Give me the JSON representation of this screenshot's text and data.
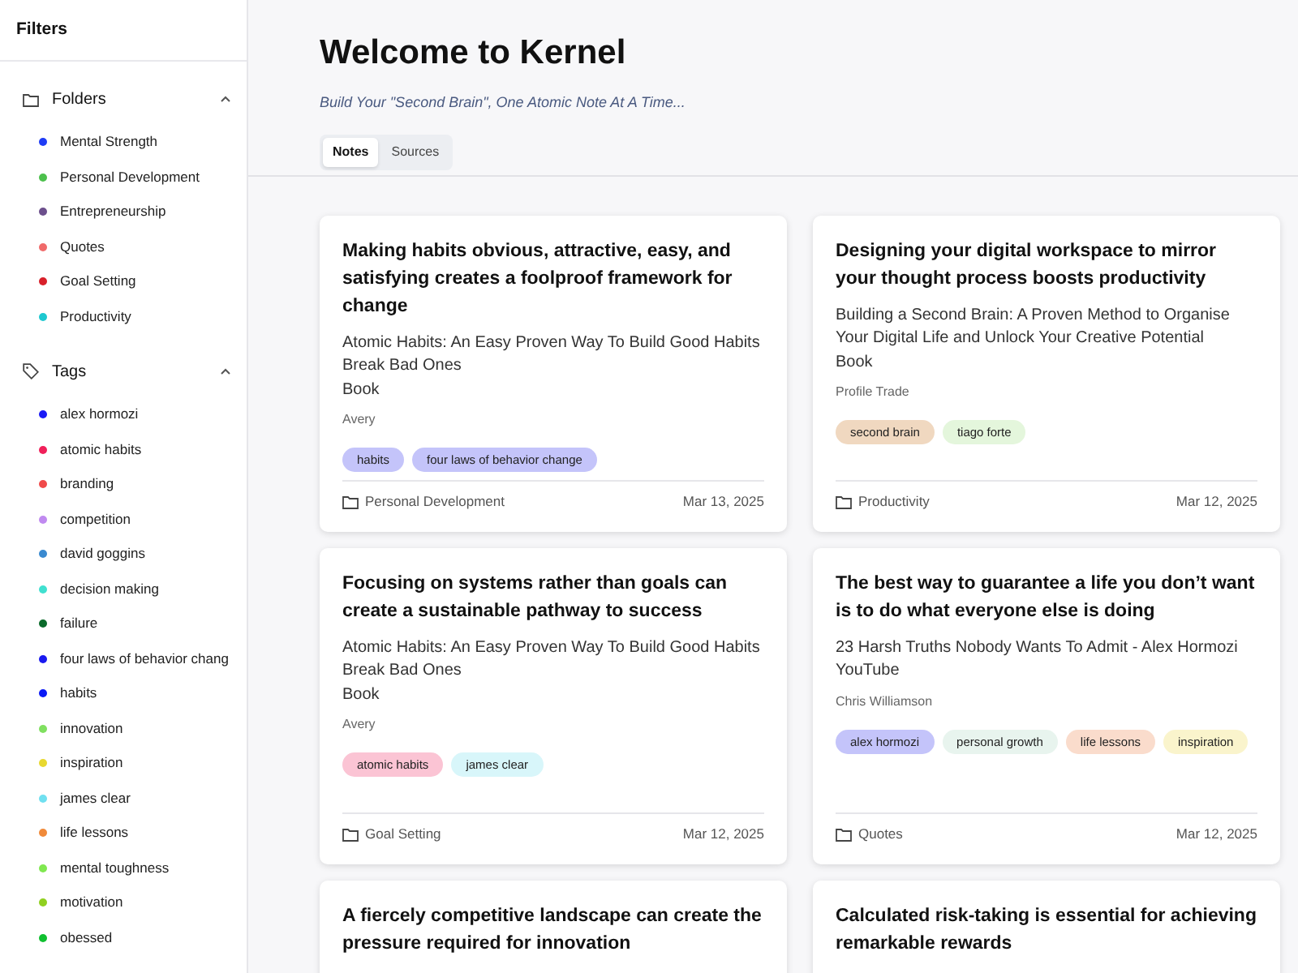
{
  "sidebar": {
    "title": "Filters",
    "sections": [
      {
        "kind": "folders",
        "label": "Folders",
        "expanded": true,
        "items": [
          {
            "label": "Mental Strength",
            "color": "#1f3cf5"
          },
          {
            "label": "Personal Development",
            "color": "#4cc04c"
          },
          {
            "label": "Entrepreneurship",
            "color": "#6c4f8c"
          },
          {
            "label": "Quotes",
            "color": "#f06a6a"
          },
          {
            "label": "Goal Setting",
            "color": "#d8202a"
          },
          {
            "label": "Productivity",
            "color": "#1ec8d0"
          }
        ]
      },
      {
        "kind": "tags",
        "label": "Tags",
        "expanded": true,
        "items": [
          {
            "label": "alex hormozi",
            "color": "#1a1af5"
          },
          {
            "label": "atomic habits",
            "color": "#f0205a"
          },
          {
            "label": "branding",
            "color": "#f04a4a"
          },
          {
            "label": "competition",
            "color": "#c08af0"
          },
          {
            "label": "david goggins",
            "color": "#3a8ad0"
          },
          {
            "label": "decision making",
            "color": "#40e0d0"
          },
          {
            "label": "failure",
            "color": "#0a6a2a"
          },
          {
            "label": "four laws of behavior chang",
            "color": "#1a1af0"
          },
          {
            "label": "habits",
            "color": "#0a1af5"
          },
          {
            "label": "innovation",
            "color": "#80e060"
          },
          {
            "label": "inspiration",
            "color": "#e8d830"
          },
          {
            "label": "james clear",
            "color": "#70e0f0"
          },
          {
            "label": "life lessons",
            "color": "#f08a3a"
          },
          {
            "label": "mental toughness",
            "color": "#80e850"
          },
          {
            "label": "motivation",
            "color": "#90d020"
          },
          {
            "label": "obessed",
            "color": "#10c030"
          }
        ]
      }
    ]
  },
  "header": {
    "title": "Welcome to Kernel",
    "subtitle": "Build Your \"Second Brain\", One Atomic Note At A Time..."
  },
  "tabs": [
    {
      "label": "Notes",
      "selected": true
    },
    {
      "label": "Sources",
      "selected": false
    }
  ],
  "notes": [
    {
      "title": "Making habits obvious, attractive, easy, and satisfying creates a foolproof framework for change",
      "source": "Atomic Habits: An Easy Proven Way To Build Good Habits Break Bad Ones",
      "source_type": "Book",
      "author": "Avery",
      "tags": [
        {
          "label": "habits",
          "color": "#c4c4fa"
        },
        {
          "label": "four laws of behavior change",
          "color": "#c4c4fa"
        }
      ],
      "folder": "Personal Development",
      "date": "Mar 13, 2025"
    },
    {
      "title": "Designing your digital workspace to mirror your thought process boosts productivity",
      "source": "Building a Second Brain: A Proven Method to Organise Your Digital Life and Unlock Your Creative Potential",
      "source_type": "Book",
      "author": "Profile Trade",
      "tags": [
        {
          "label": "second brain",
          "color": "#f0d8c0"
        },
        {
          "label": "tiago forte",
          "color": "#e4f6dc"
        }
      ],
      "folder": "Productivity",
      "date": "Mar 12, 2025"
    },
    {
      "title": "Focusing on systems rather than goals can create a sustainable pathway to success",
      "source": "Atomic Habits: An Easy Proven Way To Build Good Habits Break Bad Ones",
      "source_type": "Book",
      "author": "Avery",
      "tags": [
        {
          "label": "atomic habits",
          "color": "#fbc4d4"
        },
        {
          "label": "james clear",
          "color": "#d8f6fa"
        }
      ],
      "folder": "Goal Setting",
      "date": "Mar 12, 2025"
    },
    {
      "title": "The best way to guarantee a life you don’t want is to do what everyone else is doing",
      "source": "23 Harsh Truths Nobody Wants To Admit - Alex Hormozi",
      "source_type": "YouTube",
      "author": "Chris Williamson",
      "tags": [
        {
          "label": "alex hormozi",
          "color": "#c4c4fa"
        },
        {
          "label": "personal growth",
          "color": "#e8f4ee"
        },
        {
          "label": "life lessons",
          "color": "#fadccc"
        },
        {
          "label": "inspiration",
          "color": "#faf4cc"
        }
      ],
      "folder": "Quotes",
      "date": "Mar 12, 2025"
    },
    {
      "title": "A fiercely competitive landscape can create the pressure required for innovation"
    },
    {
      "title": "Calculated risk-taking is essential for achieving remarkable rewards"
    }
  ]
}
